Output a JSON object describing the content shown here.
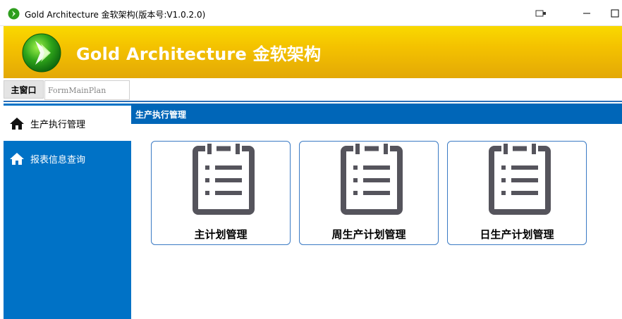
{
  "window": {
    "title": "Gold Architecture 金软架构(版本号:V1.0.2.0)"
  },
  "banner": {
    "brand": "Gold Architecture 金软架构"
  },
  "tabs": {
    "main_label": "主窗口",
    "form_field_value": "FormMainPlan"
  },
  "sidebar": {
    "items": [
      {
        "label": "生产执行管理",
        "icon": "home-icon",
        "active": true
      },
      {
        "label": "报表信息查询",
        "icon": "home-icon",
        "active": false
      }
    ]
  },
  "section": {
    "title": "生产执行管理"
  },
  "cards": [
    {
      "label": "主计划管理",
      "icon": "clipboard-list-icon"
    },
    {
      "label": "周生产计划管理",
      "icon": "clipboard-list-icon"
    },
    {
      "label": "日生产计划管理",
      "icon": "clipboard-list-icon"
    }
  ],
  "colors": {
    "banner_gold": "#f4c200",
    "sidebar_blue": "#0072c6",
    "header_blue": "#0066b8",
    "card_border": "#3a7ac4",
    "icon_gray": "#55545c"
  }
}
